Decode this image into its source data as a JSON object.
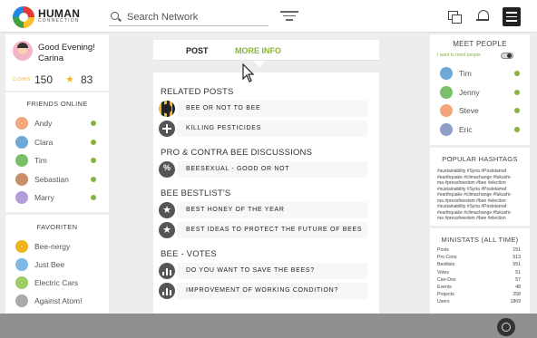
{
  "header": {
    "brand_line1": "HUMAN",
    "brand_line2": "CONNECTION",
    "search_placeholder": "Search Network",
    "icons": [
      "search-icon",
      "filter-icon",
      "windows-icon",
      "bell-icon",
      "menu-icon"
    ]
  },
  "user": {
    "greeting_line1": "Good Evening!",
    "greeting_line2": "Carina",
    "coins_label": "COINS",
    "coins": "150",
    "rating": "83"
  },
  "friends": {
    "title": "FRIENDS ONLINE",
    "items": [
      {
        "name": "Andy",
        "color": "#f3a67a"
      },
      {
        "name": "Clara",
        "color": "#6fa8d8"
      },
      {
        "name": "Tim",
        "color": "#7bbf6a"
      },
      {
        "name": "Sebastian",
        "color": "#c98e6a"
      },
      {
        "name": "Marry",
        "color": "#b39ddb"
      }
    ]
  },
  "favorites": {
    "title": "FAVORITEN",
    "items": [
      {
        "name": "Bee-nergy",
        "color": "#f3b623"
      },
      {
        "name": "Just Bee",
        "color": "#7db9e8"
      },
      {
        "name": "Electric Cars",
        "color": "#9ccc65"
      },
      {
        "name": "Against Atom!",
        "color": "#aaaaaa"
      }
    ]
  },
  "tabs": {
    "post": "POST",
    "more_info": "MORE INFO"
  },
  "groups": [
    {
      "title": "RELATED POSTS",
      "items": [
        {
          "label": "BEE OR NOT TO BEE",
          "icon": "bee"
        },
        {
          "label": "KILLING PESTICIDES",
          "icon": "plus"
        }
      ]
    },
    {
      "title": "PRO & CONTRA BEE DISCUSSIONS",
      "items": [
        {
          "label": "BEESEXUAL - GOOD OR NOT",
          "icon": "pct"
        }
      ]
    },
    {
      "title": "BEE BESTLIST'S",
      "items": [
        {
          "label": "BEST HONEY OF THE YEAR",
          "icon": "star"
        },
        {
          "label": "BEST IDEAS TO PROTECT THE FUTURE OF BEES",
          "icon": "star"
        }
      ]
    },
    {
      "title": "BEE - VOTES",
      "items": [
        {
          "label": "DO YOU WANT TO SAVE THE BEES?",
          "icon": "chart"
        },
        {
          "label": "IMPROVEMENT OF WORKING CONDITION?",
          "icon": "chart"
        }
      ]
    }
  ],
  "meet": {
    "title": "MEET PEOPLE",
    "toggle_label": "I want to meet people",
    "people": [
      {
        "name": "Tim",
        "color": "#6fa8d8"
      },
      {
        "name": "Jenny",
        "color": "#7bbf6a"
      },
      {
        "name": "Steve",
        "color": "#f3a67a"
      },
      {
        "name": "Eric",
        "color": "#8e9fc7"
      }
    ]
  },
  "hashtags": {
    "title": "POPULAR HASHTAGS",
    "lines": [
      "#sustainability #Syria #Poststamaf",
      "#earthquake #climachange #fukushi-",
      "ma #pressfreedom #bee #election",
      "#sustainability #Syria #Poststamaf",
      "#earthquake #climachange #fukushi-",
      "ma #pressfreedom #bee #election",
      "#sustainability #Syria #Poststamaf",
      "#earthquake #climachange #fukushi-",
      "ma #pressfreedom #bee #election"
    ]
  },
  "ministats": {
    "title": "MINISTATS (ALL TIME)",
    "rows": [
      {
        "label": "Posts",
        "value": "151"
      },
      {
        "label": "Pro Cons",
        "value": "513"
      },
      {
        "label": "Bestlists",
        "value": "551"
      },
      {
        "label": "Votes",
        "value": "51"
      },
      {
        "label": "Can-Dos",
        "value": "57"
      },
      {
        "label": "Events",
        "value": "48"
      },
      {
        "label": "Projects",
        "value": "258"
      },
      {
        "label": "Users",
        "value": "1869"
      }
    ]
  },
  "colors": {
    "accent": "#8ab33e",
    "gold": "#f3b623",
    "dark": "#222222"
  }
}
